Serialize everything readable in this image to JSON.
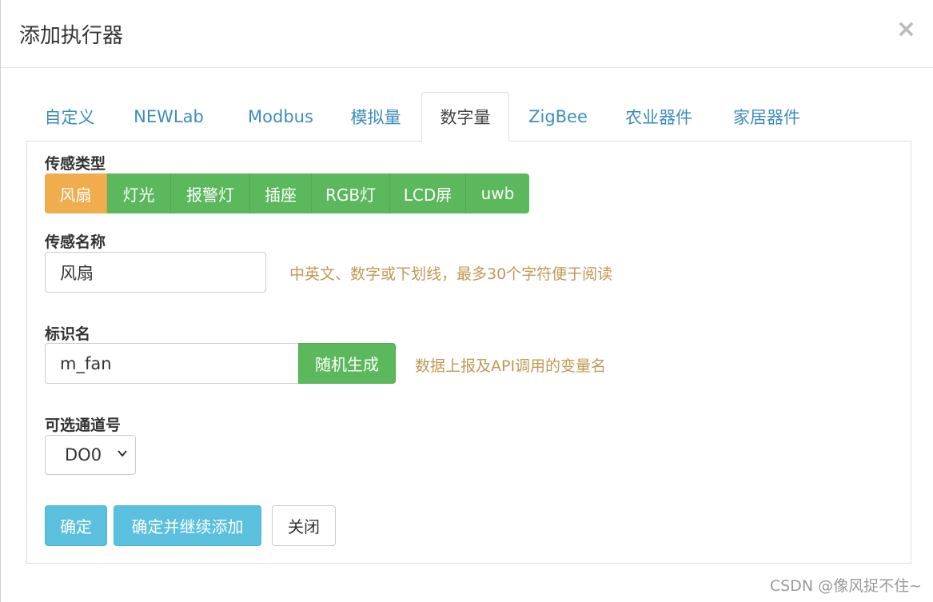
{
  "dialog": {
    "title": "添加执行器",
    "close_glyph": "×"
  },
  "tabs": [
    {
      "label": "自定义"
    },
    {
      "label": "NEWLab"
    },
    {
      "label": "Modbus"
    },
    {
      "label": "模拟量"
    },
    {
      "label": "数字量",
      "active": true
    },
    {
      "label": "ZigBee"
    },
    {
      "label": "农业器件"
    },
    {
      "label": "家居器件"
    }
  ],
  "sensor_type": {
    "label": "传感类型",
    "options": [
      "风扇",
      "灯光",
      "报警灯",
      "插座",
      "RGB灯",
      "LCD屏",
      "uwb"
    ],
    "selected": "风扇"
  },
  "sensor_name": {
    "label": "传感名称",
    "value": "风扇",
    "hint": "中英文、数字或下划线，最多30个字符便于阅读"
  },
  "identifier": {
    "label": "标识名",
    "value": "m_fan",
    "random_button": "随机生成",
    "hint": "数据上报及API调用的变量名"
  },
  "channel": {
    "label": "可选通道号",
    "selected": "DO0"
  },
  "actions": {
    "confirm": "确定",
    "confirm_continue": "确定并继续添加",
    "close": "关闭"
  },
  "watermark": "CSDN @像风捉不住~",
  "colors": {
    "link": "#3c8dbc",
    "success": "#5cb85c",
    "warning": "#f0ad4e",
    "info": "#5bc0de",
    "hint": "#c09853"
  }
}
